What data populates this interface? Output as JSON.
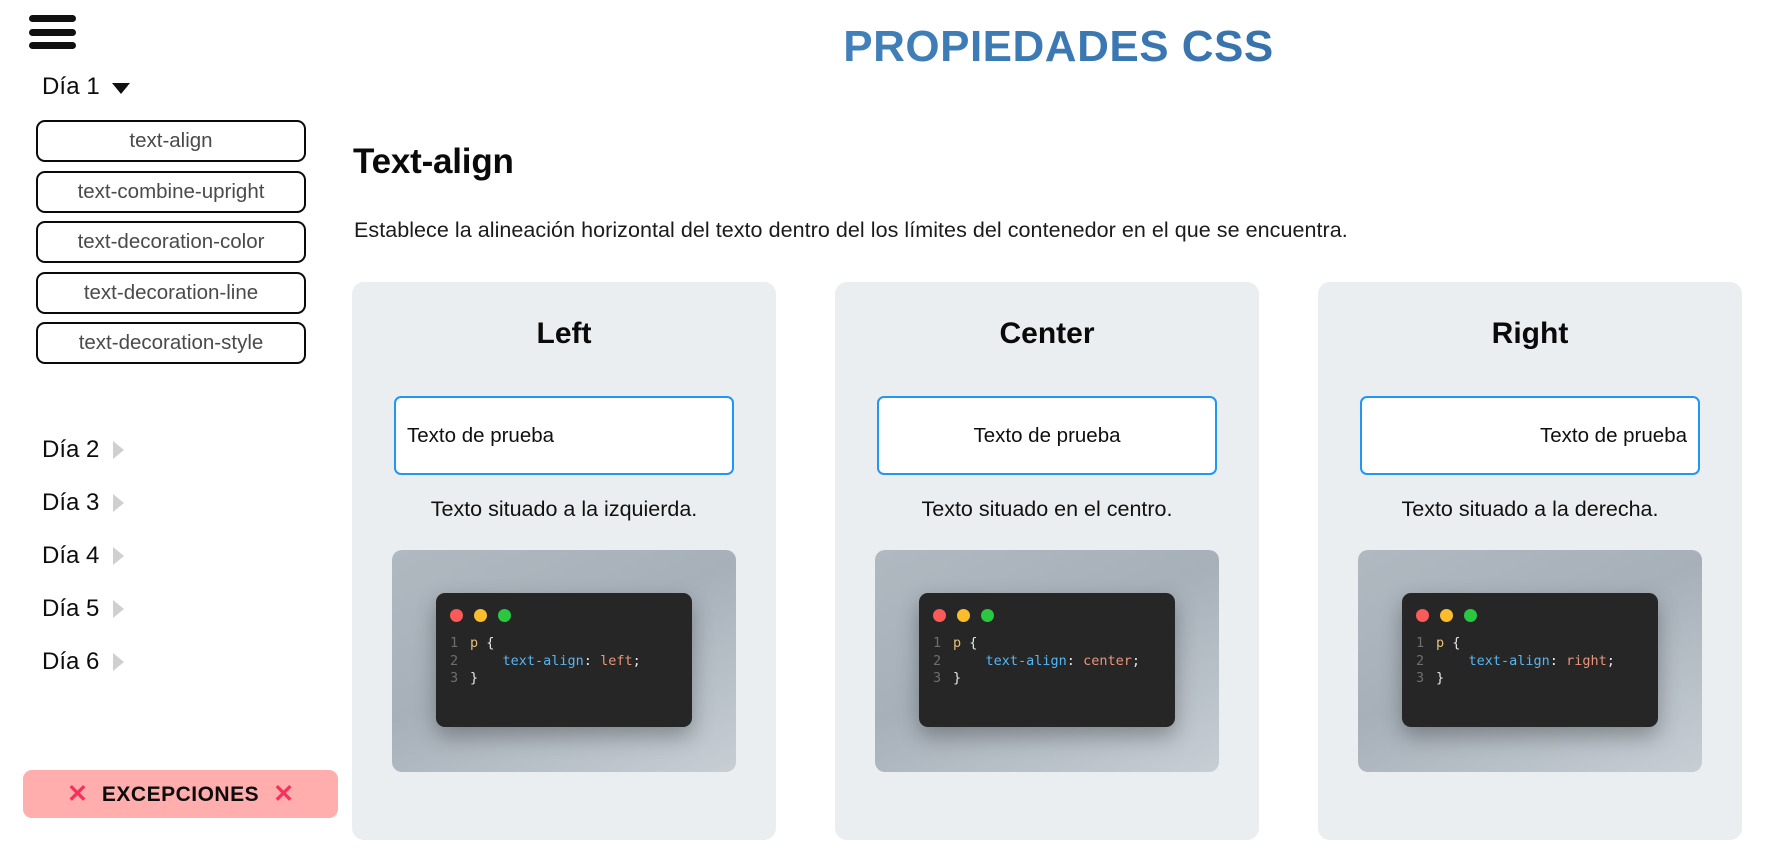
{
  "header": {
    "title": "PROPIEDADES CSS",
    "title_gradient_from": "#5593c9",
    "title_gradient_to": "#2f63a0"
  },
  "sidebar": {
    "menu_icon": "hamburger-icon",
    "current_day": {
      "label": "Día 1",
      "expanded": true,
      "caret": "chevron-down-icon"
    },
    "properties": [
      {
        "label": "text-align",
        "selected": true
      },
      {
        "label": "text-combine-upright",
        "selected": false
      },
      {
        "label": "text-decoration-color",
        "selected": false
      },
      {
        "label": "text-decoration-line",
        "selected": false
      },
      {
        "label": "text-decoration-style",
        "selected": false
      }
    ],
    "days": [
      {
        "label": "Día 2",
        "caret": "chevron-right-icon"
      },
      {
        "label": "Día 3",
        "caret": "chevron-right-icon"
      },
      {
        "label": "Día 4",
        "caret": "chevron-right-icon"
      },
      {
        "label": "Día 5",
        "caret": "chevron-right-icon"
      },
      {
        "label": "Día 6",
        "caret": "chevron-right-icon"
      }
    ],
    "exceptions_button": {
      "label": "EXCEPCIONES",
      "left_icon": "x-icon",
      "right_icon": "x-icon",
      "left_icon_glyph": "✕",
      "right_icon_glyph": "✕",
      "background": "#ffadad",
      "icon_color": "#f5325b"
    }
  },
  "main": {
    "section_title": "Text-align",
    "section_description": "Establece la alineación horizontal del texto dentro del los límites del contenedor en el que se encuentra.",
    "cards": [
      {
        "title": "Left",
        "demo_text": "Texto de prueba",
        "align": "left",
        "caption": "Texto situado a la izquierda.",
        "code": {
          "line_numbers": [
            "1",
            "2",
            "3"
          ],
          "selector": "p",
          "open_brace": " {",
          "property": "text-align",
          "colon": ": ",
          "value": "left",
          "semicolon": ";",
          "close_brace": "}"
        }
      },
      {
        "title": "Center",
        "demo_text": "Texto de prueba",
        "align": "center",
        "caption": "Texto situado en el centro.",
        "code": {
          "line_numbers": [
            "1",
            "2",
            "3"
          ],
          "selector": "p",
          "open_brace": " {",
          "property": "text-align",
          "colon": ": ",
          "value": "center",
          "semicolon": ";",
          "close_brace": "}"
        }
      },
      {
        "title": "Right",
        "demo_text": "Texto de prueba",
        "align": "right",
        "caption": "Texto situado a la derecha.",
        "code": {
          "line_numbers": [
            "1",
            "2",
            "3"
          ],
          "selector": "p",
          "open_brace": " {",
          "property": "text-align",
          "colon": ": ",
          "value": "right",
          "semicolon": ";",
          "close_brace": "}"
        }
      }
    ]
  },
  "colors": {
    "card_background": "#eaeef0",
    "demo_border": "#2196f3",
    "code_window_bg": "#262627",
    "dot_red": "#fa5b58",
    "dot_yellow": "#fbbd2e",
    "dot_green": "#2ac841"
  }
}
